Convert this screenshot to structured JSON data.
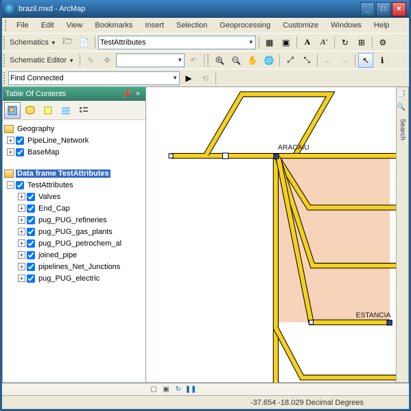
{
  "window": {
    "title": "brazil.mxd - ArcMap"
  },
  "menu": {
    "items": [
      "File",
      "Edit",
      "View",
      "Bookmarks",
      "Insert",
      "Selection",
      "Geoprocessing",
      "Customize",
      "Windows",
      "Help"
    ]
  },
  "tool_schematics": {
    "label": "Schematics",
    "combo_value": "TestAttributes"
  },
  "tool_editor": {
    "label": "Schematic Editor"
  },
  "tool_findconnected": {
    "value": "Find Connected"
  },
  "toc": {
    "title": "Table Of Contents",
    "df1": {
      "label": "Geography",
      "layers": [
        "PipeLine_Network",
        "BaseMap"
      ]
    },
    "df2": {
      "label": "Data frame TestAttributes",
      "group": "TestAttributes",
      "layers": [
        "Valves",
        "End_Cap",
        "pug_PUG_refineries",
        "pug_PUG_gas_plants",
        "pug_PUG_petrochem_al",
        "joined_pipe",
        "pipelines_Net_Junctions",
        "pug_PUG_electric"
      ]
    }
  },
  "map": {
    "label1": "ARACAIU",
    "label2": "ESTANCIA"
  },
  "sidebar": {
    "search": "Search"
  },
  "status": {
    "coords": "-37.654  -18.029 Decimal Degrees"
  }
}
